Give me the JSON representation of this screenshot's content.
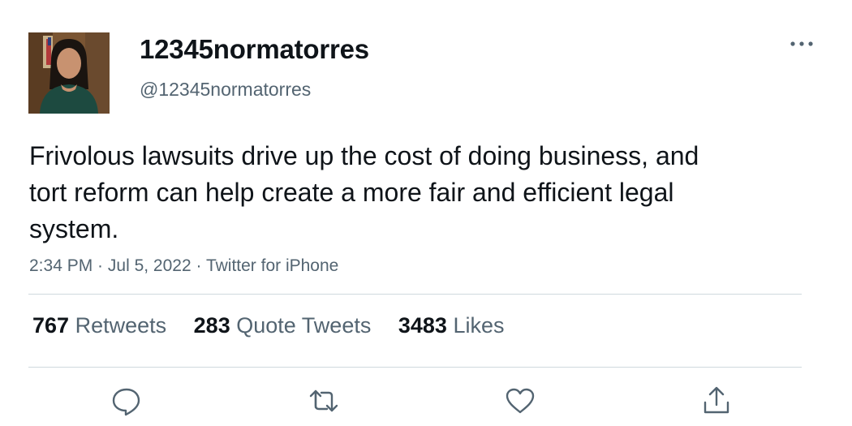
{
  "user": {
    "display_name": "12345normatorres",
    "handle": "@12345normatorres"
  },
  "tweet": {
    "text": "Frivolous lawsuits drive up the cost of doing business, and tort reform can help create a more fair and efficient legal system.",
    "time": "2:34 PM",
    "date": "Jul 5, 2022",
    "source": "Twitter for iPhone",
    "separator": " · "
  },
  "stats": [
    {
      "count": "767",
      "label": "Retweets"
    },
    {
      "count": "283",
      "label": "Quote Tweets"
    },
    {
      "count": "3483",
      "label": "Likes"
    }
  ],
  "icons": {
    "more": "more-horizontal-icon",
    "reply": "reply-icon",
    "retweet": "retweet-icon",
    "like": "heart-icon",
    "share": "share-icon"
  },
  "colors": {
    "text": "#0f1419",
    "secondary": "#536471",
    "divider": "#cfd9de"
  }
}
